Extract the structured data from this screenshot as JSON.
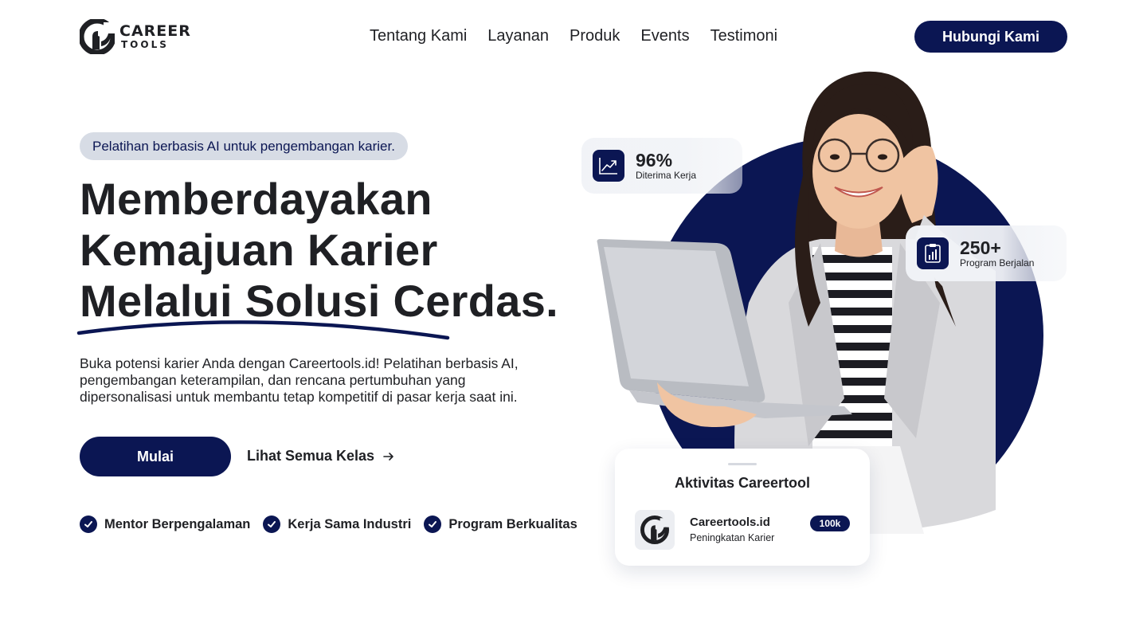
{
  "header": {
    "logo": {
      "line1": "CAREER",
      "line2": "TOOLS"
    },
    "nav": [
      "Tentang Kami",
      "Layanan",
      "Produk",
      "Events",
      "Testimoni"
    ],
    "contact_label": "Hubungi Kami"
  },
  "hero": {
    "badge": "Pelatihan berbasis AI untuk pengembangan karier.",
    "headline": [
      "Memberdayakan",
      "Kemajuan Karier",
      "Melalui Solusi Cerdas."
    ],
    "description": "Buka potensi karier Anda dengan Careertools.id! Pelatihan berbasis AI, pengembangan keterampilan, dan rencana pertumbuhan yang dipersonalisasi untuk membantu tetap kompetitif di pasar kerja saat ini.",
    "primary_cta": "Mulai",
    "secondary_cta": "Lihat Semua Kelas",
    "features": [
      "Mentor Berpengalaman",
      "Kerja Sama Industri",
      "Program Berkualitas"
    ]
  },
  "stats": [
    {
      "value": "96%",
      "label": "Diterima Kerja",
      "icon": "trend-chart-icon"
    },
    {
      "value": "250+",
      "label": "Program Berjalan",
      "icon": "clipboard-chart-icon"
    }
  ],
  "activity": {
    "title": "Aktivitas Careertool",
    "name": "Careertools.id",
    "subtitle": "Peningkatan Karier",
    "badge": "100k"
  },
  "colors": {
    "brand": "#0b1653",
    "text": "#1f2024",
    "badge_bg": "#d7dce5"
  }
}
